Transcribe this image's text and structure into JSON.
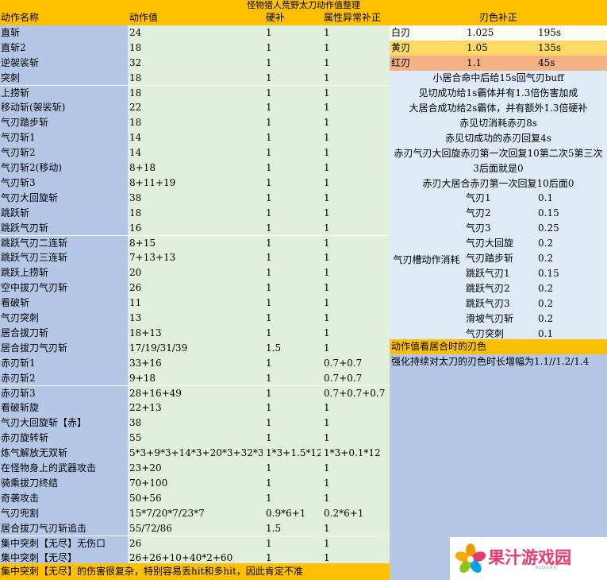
{
  "title": "怪物猎人荒野太刀动作值整理",
  "table": {
    "headers": [
      "动作名称",
      "动作值",
      "硬补",
      "属性异常补正"
    ],
    "rows": [
      [
        "直斩",
        "24",
        "1",
        "1"
      ],
      [
        "直斩2",
        "18",
        "1",
        "1"
      ],
      [
        "逆袈裟斩",
        "32",
        "1",
        "1"
      ],
      [
        "突刺",
        "18",
        "1",
        "1"
      ],
      [
        "上捞斩",
        "18",
        "1",
        "1"
      ],
      [
        "移动斩(袈裟斩)",
        "22",
        "1",
        "1"
      ],
      [
        "气刃踏步斩",
        "18",
        "1",
        "1"
      ],
      [
        "气刃斩1",
        "14",
        "1",
        "1"
      ],
      [
        "气刃斩2",
        "14",
        "1",
        "1"
      ],
      [
        "气刃斩2(移动)",
        "8+18",
        "1",
        "1"
      ],
      [
        "气刃斩3",
        "8+11+19",
        "1",
        "1"
      ],
      [
        "气刃大回旋斩",
        "38",
        "1",
        "1"
      ],
      [
        "跳跃斩",
        "18",
        "1",
        "1"
      ],
      [
        "跳跃气刃斩",
        "16",
        "1",
        "1"
      ],
      [
        "跳跃气刃二连斩",
        "8+15",
        "1",
        "1"
      ],
      [
        "跳跃气刃三连斩",
        "7+13+13",
        "1",
        "1"
      ],
      [
        "跳跃上捞斩",
        "20",
        "1",
        "1"
      ],
      [
        "空中拔刀气刃斩",
        "26",
        "1",
        "1"
      ],
      [
        "看破斩",
        "11",
        "1",
        "1"
      ],
      [
        "气刃突刺",
        "13",
        "1",
        "1"
      ],
      [
        "居合拔刀斩",
        "18+13",
        "1",
        "1"
      ],
      [
        "居合拔刀气刃斩",
        "17/19/31/39",
        "1.5",
        "1"
      ],
      [
        "赤刃斩1",
        "33+16",
        "1",
        "0.7+0.7"
      ],
      [
        "赤刃斩2",
        "9+18",
        "1",
        "0.7+0.7"
      ],
      [
        "赤刃斩3",
        "28+16+49",
        "1",
        "0.7+0.7+0.7"
      ],
      [
        "看破斩旋",
        "22+13",
        "1",
        "1"
      ],
      [
        "气刃大回旋斩【赤】",
        "38",
        "1",
        "1"
      ],
      [
        "赤刃旋转斩",
        "55",
        "1",
        "1"
      ],
      [
        "炼气解放无双斩",
        "5*3+9*3+14*3+20*3+32*3",
        "1*3+1.5*12",
        "1*3+0.1*12"
      ],
      [
        "在怪物身上的武器攻击",
        "23+20",
        "1",
        "1"
      ],
      [
        "骑乘拔刀终结",
        "70+100",
        "1",
        "1"
      ],
      [
        "奇袭攻击",
        "50+56",
        "1",
        "1"
      ],
      [
        "气刃兜割",
        "15*7/20*7/23*7",
        "0.9*6+1",
        "0.2*6+1"
      ],
      [
        "居合拔刀气刃斩追击",
        "55/72/86",
        "1.5",
        "1"
      ],
      [
        "集中突刺【无尽】无伤口",
        "26",
        "1",
        "1"
      ],
      [
        "集中突刺【无尽】",
        "26+26+10+40*2+60",
        "1",
        "1"
      ]
    ],
    "footer": "集中突刺【无尽】的伤害很复杂，特别容易丢hit和多hit，因此肯定不准"
  },
  "blade": {
    "header": "刃色补正",
    "rows": [
      {
        "name": "白刃",
        "mult": "1.025",
        "time": "195s"
      },
      {
        "name": "黄刃",
        "mult": "1.05",
        "time": "135s"
      },
      {
        "name": "红刃",
        "mult": "1.1",
        "time": "45s"
      }
    ],
    "colors": {
      "white": "#fbfbf5",
      "yellow": "#ffd966",
      "red": "#f4b183"
    }
  },
  "notes": [
    "小居合命中后给15s回气刃buff",
    "见切成功给1s霸体并有1.3倍伤害加成",
    "大居合成功给2s霸体，并有额外1.3倍硬补",
    "赤见切消耗赤刃8s",
    "赤见切成功的赤刃回复4s",
    "赤刃气刃大回旋赤刃第一次回复10第二次5第三次3后面就是0",
    "赤刃大居合赤刃第一次回复10后面0"
  ],
  "gauge": {
    "label": "气刃槽动作消耗",
    "rows": [
      {
        "name": "气刃1",
        "val": "0.1"
      },
      {
        "name": "气刃2",
        "val": "0.15"
      },
      {
        "name": "气刃3",
        "val": "0.25"
      },
      {
        "name": "气刃大回旋",
        "val": "0.2"
      },
      {
        "name": "气刃踏步斩",
        "val": "0.2"
      },
      {
        "name": "跳跃气刃1",
        "val": "0.15"
      },
      {
        "name": "跳跃气刃2",
        "val": "0.2"
      },
      {
        "name": "跳跃气刃3",
        "val": "0.2"
      },
      {
        "name": "滑坡气刃斩",
        "val": "0.2"
      },
      {
        "name": "气刃突刺",
        "val": "0.1"
      }
    ]
  },
  "section": {
    "header": "动作值看居合时的刃色",
    "text": "强化持续对太刀的刃色时长增幅为1.1//1.2/1.4"
  },
  "logo": {
    "text": "果汁游戏园",
    "sub": "BLOGAN"
  },
  "palette": {
    "header": "#ffc000",
    "name_col": "#b4c7e7",
    "value_col": "#e2efda",
    "notes_bg": "#deebf7",
    "logo": "#e83a6e"
  }
}
